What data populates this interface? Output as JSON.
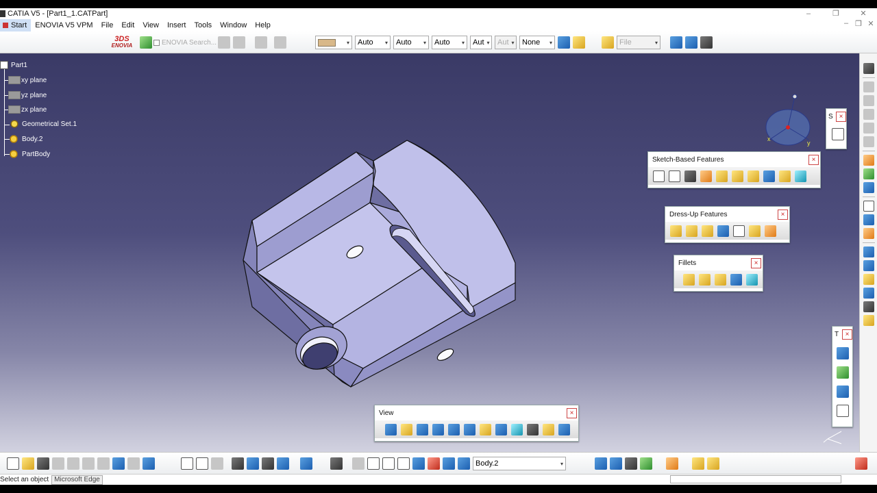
{
  "window": {
    "title": "CATIA V5 - [Part1_1.CATPart]",
    "controls": [
      "–",
      "❐",
      "✕"
    ],
    "mdi_controls": [
      "–",
      "❐",
      "✕"
    ]
  },
  "menu": [
    "Start",
    "ENOVIA V5 VPM",
    "File",
    "Edit",
    "View",
    "Insert",
    "Tools",
    "Window",
    "Help"
  ],
  "top_toolbar": {
    "enovia_logo": "ENOVIA",
    "enovia_search": "ENOVIA Search...",
    "color_arrow": "▾",
    "linetype": "Auto",
    "thickness": "Auto",
    "layer": "Auto",
    "extra1": "Aut",
    "extra2": "Aut",
    "render": "None",
    "file_filter": "File"
  },
  "tree": {
    "root": "Part1",
    "items": [
      "xy plane",
      "yz plane",
      "zx plane",
      "Geometrical Set.1",
      "Body.2",
      "PartBody"
    ]
  },
  "panels": {
    "sketch_based": {
      "title": "Sketch-Based Features",
      "close": "×"
    },
    "dress_up": {
      "title": "Dress-Up Features",
      "close": "×"
    },
    "fillets": {
      "title": "Fillets",
      "close": "×"
    },
    "view": {
      "title": "View",
      "close": "×"
    },
    "sketcher_mini": {
      "title": "S",
      "close": "×"
    },
    "tools_mini": {
      "title": "T",
      "close": "×"
    }
  },
  "bottom_toolbar": {
    "body_select": "Body.2",
    "icons": [
      "new-icon",
      "open-icon",
      "save-icon",
      "print-icon",
      "cut-icon",
      "copy-icon",
      "paste-icon",
      "undo-icon",
      "redo-icon",
      "whats-this-icon",
      "formula-icon",
      "knowledge-icon",
      "ruler-icon",
      "table-icon",
      "law-icon",
      "catalog-icon",
      "apply-material-icon",
      "capture-icon",
      "update-icon",
      "measure-icon",
      "axis-icon",
      "angle-icon",
      "compass-icon",
      "scan-icon"
    ]
  },
  "status": {
    "message": "Select an object",
    "tooltip": "Microsoft Edge"
  },
  "compass": {
    "x_label": "x",
    "y_label": "y"
  }
}
